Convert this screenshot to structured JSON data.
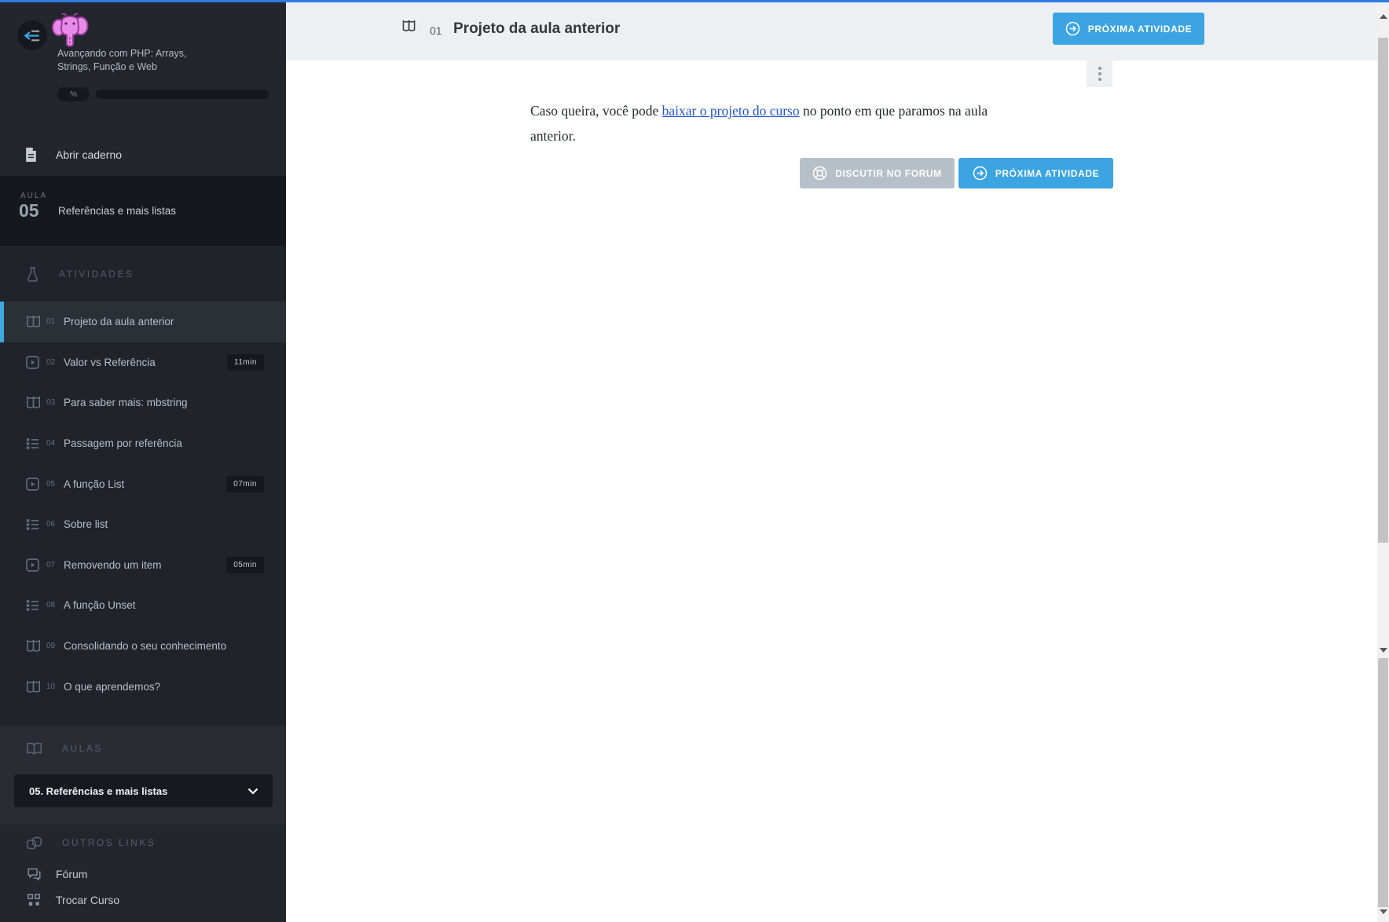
{
  "colors": {
    "accent_blue": "#3ba4e1",
    "top_border_blue": "#2b7ee2",
    "active_item_bar": "#41a7e1",
    "link_blue": "#2257cc",
    "grey_button": "#b7c0c7"
  },
  "course": {
    "title_line1": "Avançando com PHP: Arrays,",
    "title_line2": "Strings, Função e Web",
    "progress_label": "%"
  },
  "sidebar": {
    "open_notebook": "Abrir caderno",
    "lesson": {
      "label": "AULA",
      "number": "05",
      "title": "Referências e mais listas"
    },
    "activities_header": "ATIVIDADES",
    "activities": [
      {
        "num": "01",
        "label": "Projeto da aula anterior",
        "icon": "book",
        "active": true
      },
      {
        "num": "02",
        "label": "Valor vs Referência",
        "icon": "video",
        "duration": "11min"
      },
      {
        "num": "03",
        "label": "Para saber mais: mbstring",
        "icon": "book"
      },
      {
        "num": "04",
        "label": "Passagem por referência",
        "icon": "list"
      },
      {
        "num": "05",
        "label": "A função List",
        "icon": "video",
        "duration": "07min"
      },
      {
        "num": "06",
        "label": "Sobre list",
        "icon": "list"
      },
      {
        "num": "07",
        "label": "Removendo um item",
        "icon": "video",
        "duration": "05min"
      },
      {
        "num": "08",
        "label": "A função Unset",
        "icon": "list"
      },
      {
        "num": "09",
        "label": "Consolidando o seu conhecimento",
        "icon": "book"
      },
      {
        "num": "10",
        "label": "O que aprendemos?",
        "icon": "book"
      }
    ],
    "aulas_header": "AULAS",
    "lesson_select": "05. Referências e mais listas",
    "other_links_header": "OUTROS LINKS",
    "links": [
      {
        "label": "Fórum",
        "icon": "forum"
      },
      {
        "label": "Trocar Curso",
        "icon": "grid"
      }
    ]
  },
  "header": {
    "num": "01",
    "title": "Projeto da aula anterior",
    "next_label": "PRÓXIMA ATIVIDADE"
  },
  "content": {
    "before_link": "Caso queira, você pode ",
    "link_text": "baixar o projeto do curso",
    "after_link": " no ponto em que paramos na aula anterior.",
    "forum_label": "DISCUTIR NO FORUM",
    "next_label": "PRÓXIMA ATIVIDADE"
  }
}
